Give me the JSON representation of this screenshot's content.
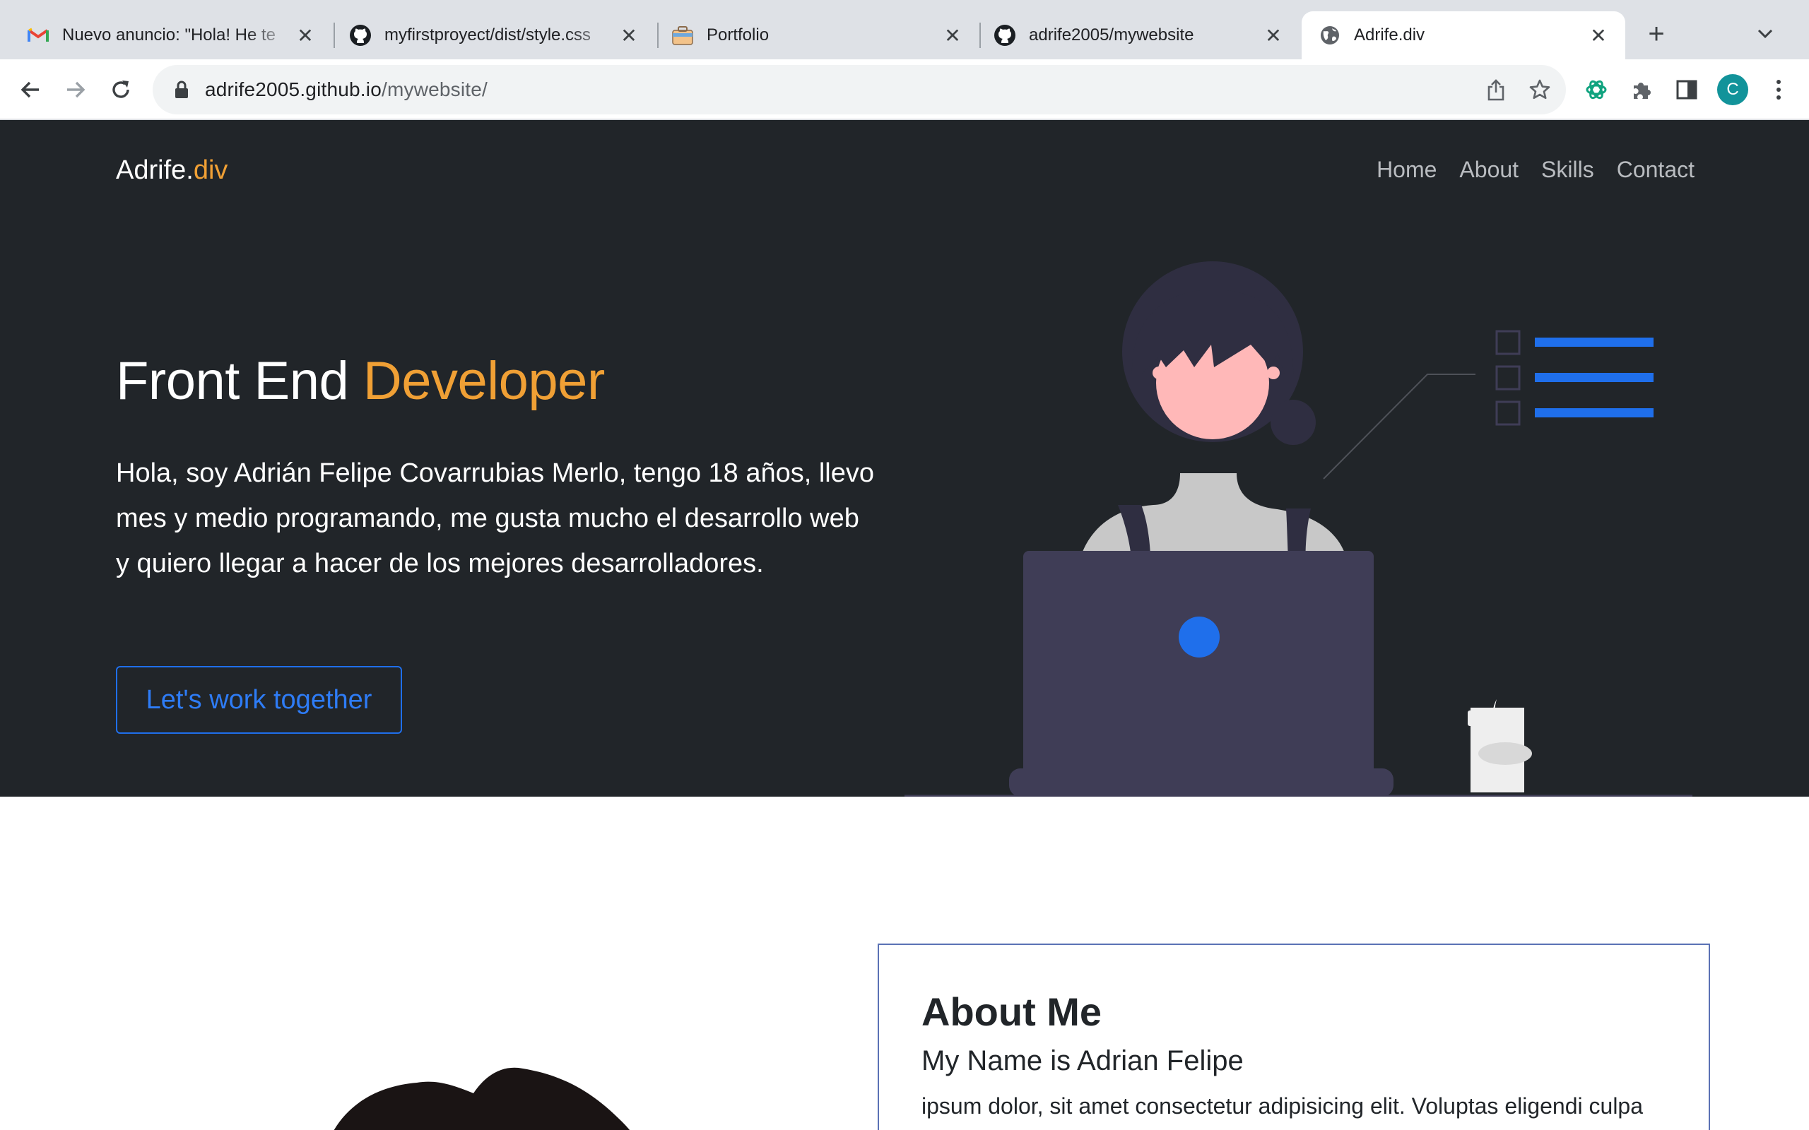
{
  "browser": {
    "tabs": [
      {
        "title": "Nuevo anuncio: \"Hola! He te",
        "icon": "gmail-icon"
      },
      {
        "title": "myfirstproyect/dist/style.css",
        "icon": "github-icon"
      },
      {
        "title": "Portfolio",
        "icon": "portfolio-icon"
      },
      {
        "title": "adrife2005/mywebsite",
        "icon": "github-icon"
      },
      {
        "title": "Adrife.div",
        "icon": "globe-icon",
        "active": true
      }
    ],
    "close_glyph": "✕",
    "newtab_glyph": "+",
    "url_host": "adrife2005.github.io",
    "url_path": "/mywebsite/",
    "profile_initial": "C"
  },
  "site": {
    "brand_main": "Adrife.",
    "brand_accent": "div",
    "nav": [
      "Home",
      "About",
      "Skills",
      "Contact"
    ],
    "hero": {
      "title_main": "Front End ",
      "title_accent": "Developer",
      "text": "Hola, soy Adrián Felipe Covarrubias Merlo, tengo 18 años, llevo mes y medio programando, me gusta mucho el desarrollo web y quiero llegar a hacer de los mejores desarrolladores.",
      "cta": "Let's work together"
    },
    "about": {
      "title": "About Me",
      "subtitle": "My Name is Adrian Felipe",
      "text": "ipsum dolor, sit amet consectetur adipisicing elit. Voluptas eligendi culpa"
    }
  },
  "colors": {
    "hero_bg": "#212529",
    "accent": "#f0a035",
    "link_blue": "#1f6feb",
    "card_border": "#5b72b5"
  }
}
